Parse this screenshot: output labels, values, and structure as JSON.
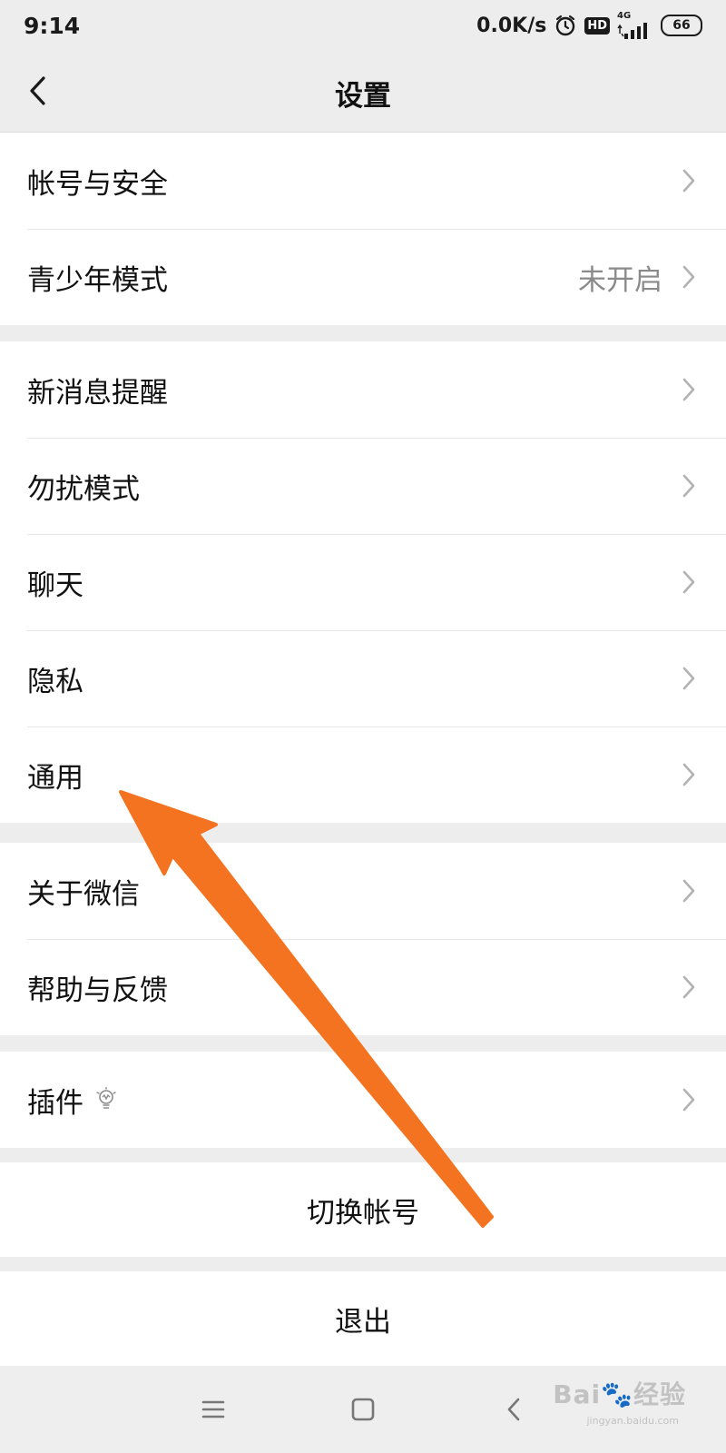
{
  "status_bar": {
    "time": "9:14",
    "speed": "0.0K/s",
    "hd": "HD",
    "network": "4G",
    "battery": "66",
    "icons": [
      "alarm-icon",
      "hd-icon",
      "signal-icon",
      "battery-icon"
    ]
  },
  "header": {
    "title": "设置",
    "back_icon": "chevron-left-icon"
  },
  "groups": [
    {
      "items": [
        {
          "label": "帐号与安全"
        },
        {
          "label": "青少年模式",
          "value": "未开启"
        }
      ]
    },
    {
      "items": [
        {
          "label": "新消息提醒"
        },
        {
          "label": "勿扰模式"
        },
        {
          "label": "聊天"
        },
        {
          "label": "隐私"
        },
        {
          "label": "通用"
        }
      ]
    },
    {
      "items": [
        {
          "label": "关于微信"
        },
        {
          "label": "帮助与反馈"
        }
      ]
    },
    {
      "items": [
        {
          "label": "插件",
          "icon": "lightbulb-icon"
        }
      ]
    }
  ],
  "actions": {
    "switch_account": "切换帐号",
    "logout": "退出"
  },
  "system_nav": {
    "icons": [
      "menu-icon",
      "home-icon",
      "back-icon"
    ]
  },
  "watermark": {
    "brand": "Bai",
    "brand_suffix": "经验",
    "domain": "jingyan.baidu.com"
  },
  "annotation": {
    "arrow_color": "#f47321"
  }
}
